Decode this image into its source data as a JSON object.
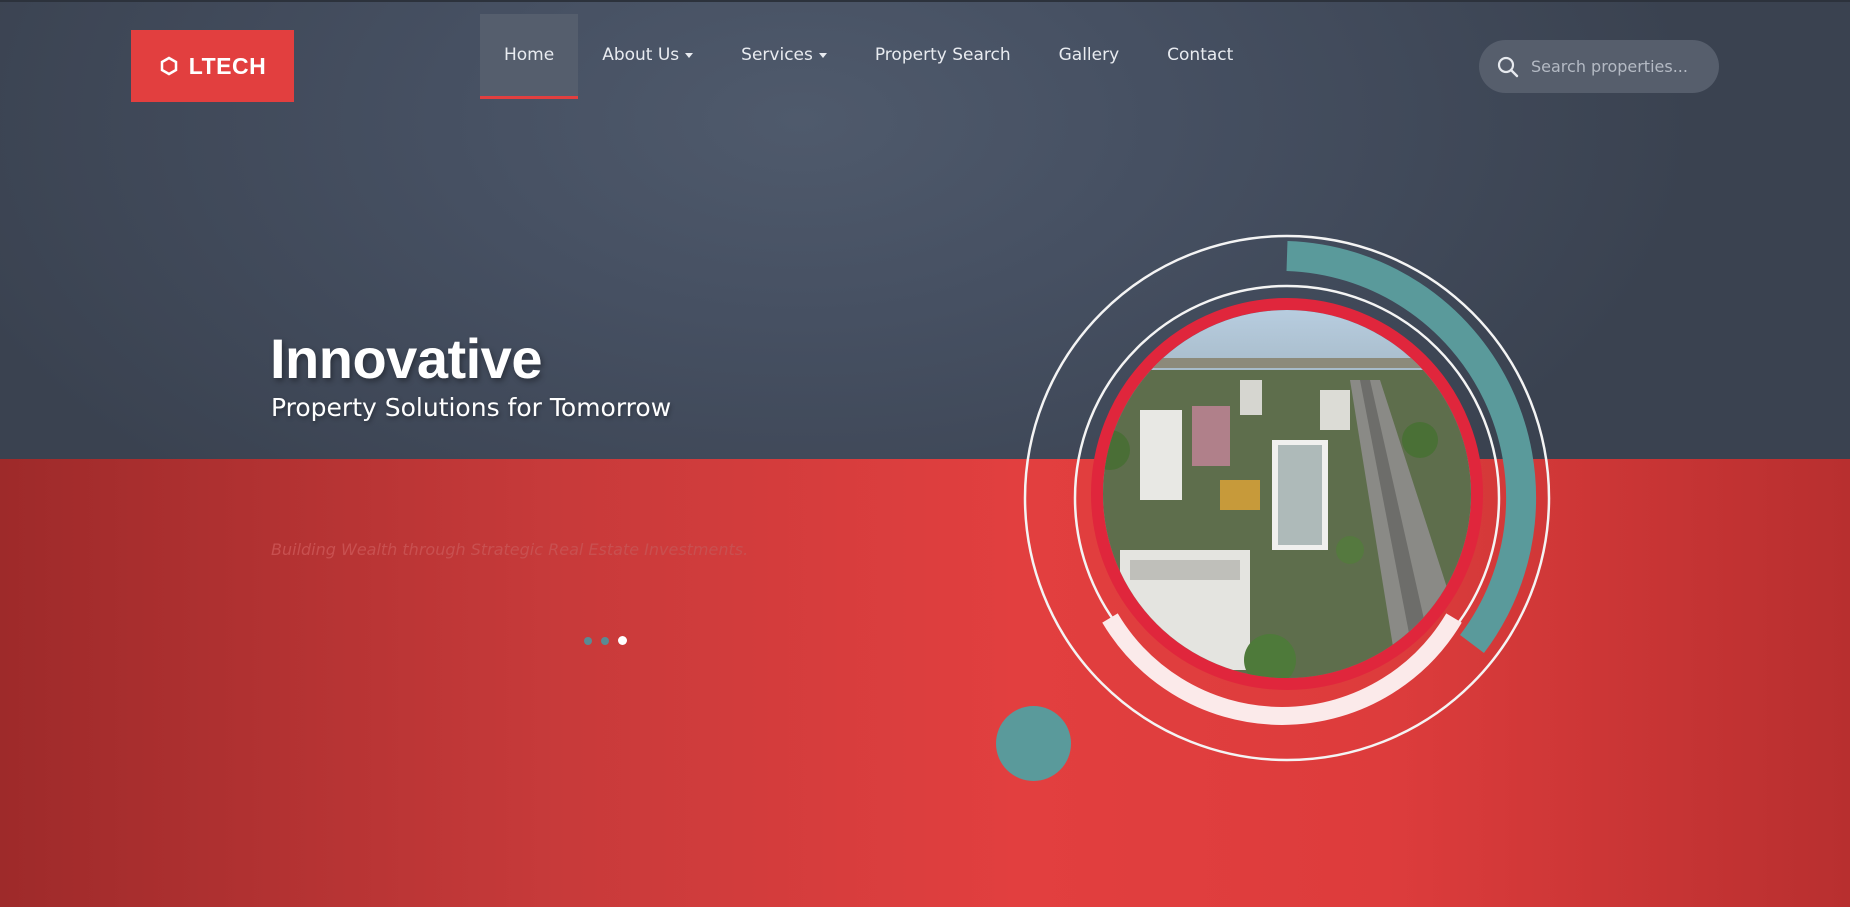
{
  "brand": {
    "name": "LTECH",
    "icon": "hexagon-icon",
    "color": "#e23f3f"
  },
  "nav": {
    "items": [
      {
        "label": "Home",
        "active": true,
        "dropdown": false
      },
      {
        "label": "About Us",
        "active": false,
        "dropdown": true
      },
      {
        "label": "Services",
        "active": false,
        "dropdown": true
      },
      {
        "label": "Property Search",
        "active": false,
        "dropdown": false
      },
      {
        "label": "Gallery",
        "active": false,
        "dropdown": false
      },
      {
        "label": "Contact",
        "active": false,
        "dropdown": false
      }
    ]
  },
  "search": {
    "placeholder": "Search properties...",
    "icon": "search-icon"
  },
  "hero": {
    "title": "Innovative",
    "subtitle": "Property Solutions for Tomorrow",
    "tagline": "Building Wealth through Strategic Real Estate Investments.",
    "slides": {
      "count": 3,
      "active_index": 2
    },
    "image_description_icon": "city-aerial-image"
  },
  "colors": {
    "accent_red": "#e23f3f",
    "teal": "#5a9a9b",
    "dark": "#465062"
  }
}
